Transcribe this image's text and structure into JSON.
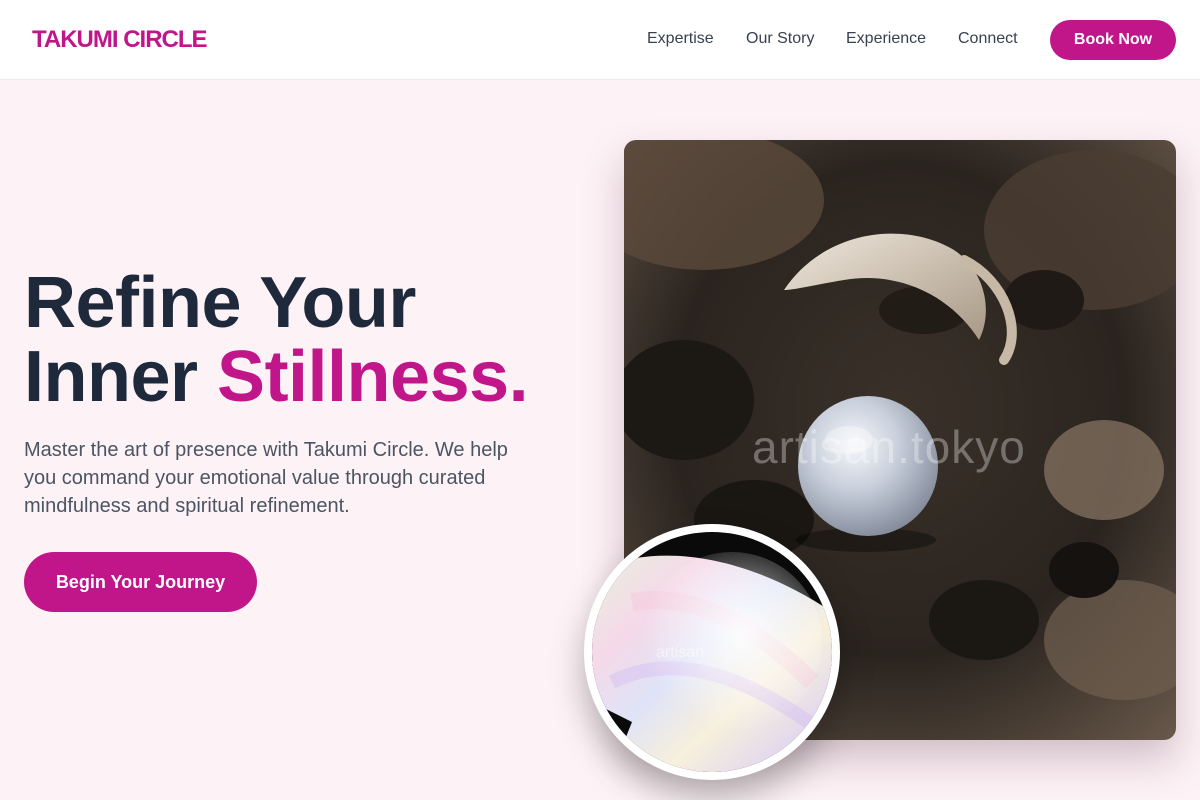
{
  "brand": {
    "name": "TAKUMI CIRCLE",
    "accent_color": "#c0168a"
  },
  "nav": {
    "links": [
      "Expertise",
      "Our Story",
      "Experience",
      "Connect"
    ],
    "book_label": "Book Now"
  },
  "hero": {
    "headline_line1": "Refine Your",
    "headline_word": "Inner",
    "headline_accent": "Stillness.",
    "description": "Master the art of presence with Takumi Circle. We help you command your emotional value through curated mindfulness and spiritual refinement.",
    "cta_label": "Begin Your Journey"
  },
  "images": {
    "main_watermark": "artisan.tokyo",
    "circle_watermark": "artisan"
  }
}
